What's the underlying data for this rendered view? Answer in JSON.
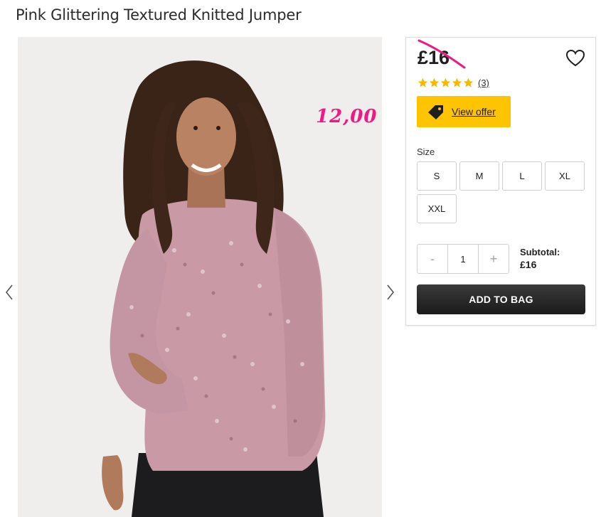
{
  "product": {
    "title": "Pink Glittering Textured Knitted Jumper",
    "price": "£16",
    "annotated_price": "12,00",
    "rating": {
      "stars": 5,
      "review_count": "(3)"
    },
    "offer_label": "View offer",
    "size_label": "Size",
    "sizes": [
      "S",
      "M",
      "L",
      "XL",
      "XXL"
    ],
    "quantity": {
      "minus": "-",
      "value": "1",
      "plus": "+"
    },
    "subtotal_label": "Subtotal:",
    "subtotal_value": "£16",
    "add_to_bag_label": "ADD TO BAG"
  },
  "icons": {
    "prev": "chevron-left-icon",
    "next": "chevron-right-icon",
    "wishlist": "heart-icon",
    "offer": "price-tag-icon",
    "star": "star-icon"
  },
  "colors": {
    "accent_yellow": "#ffc400",
    "annotation_pink": "#f01882",
    "star_gold": "#f5b800",
    "button_dark": "#222222"
  }
}
